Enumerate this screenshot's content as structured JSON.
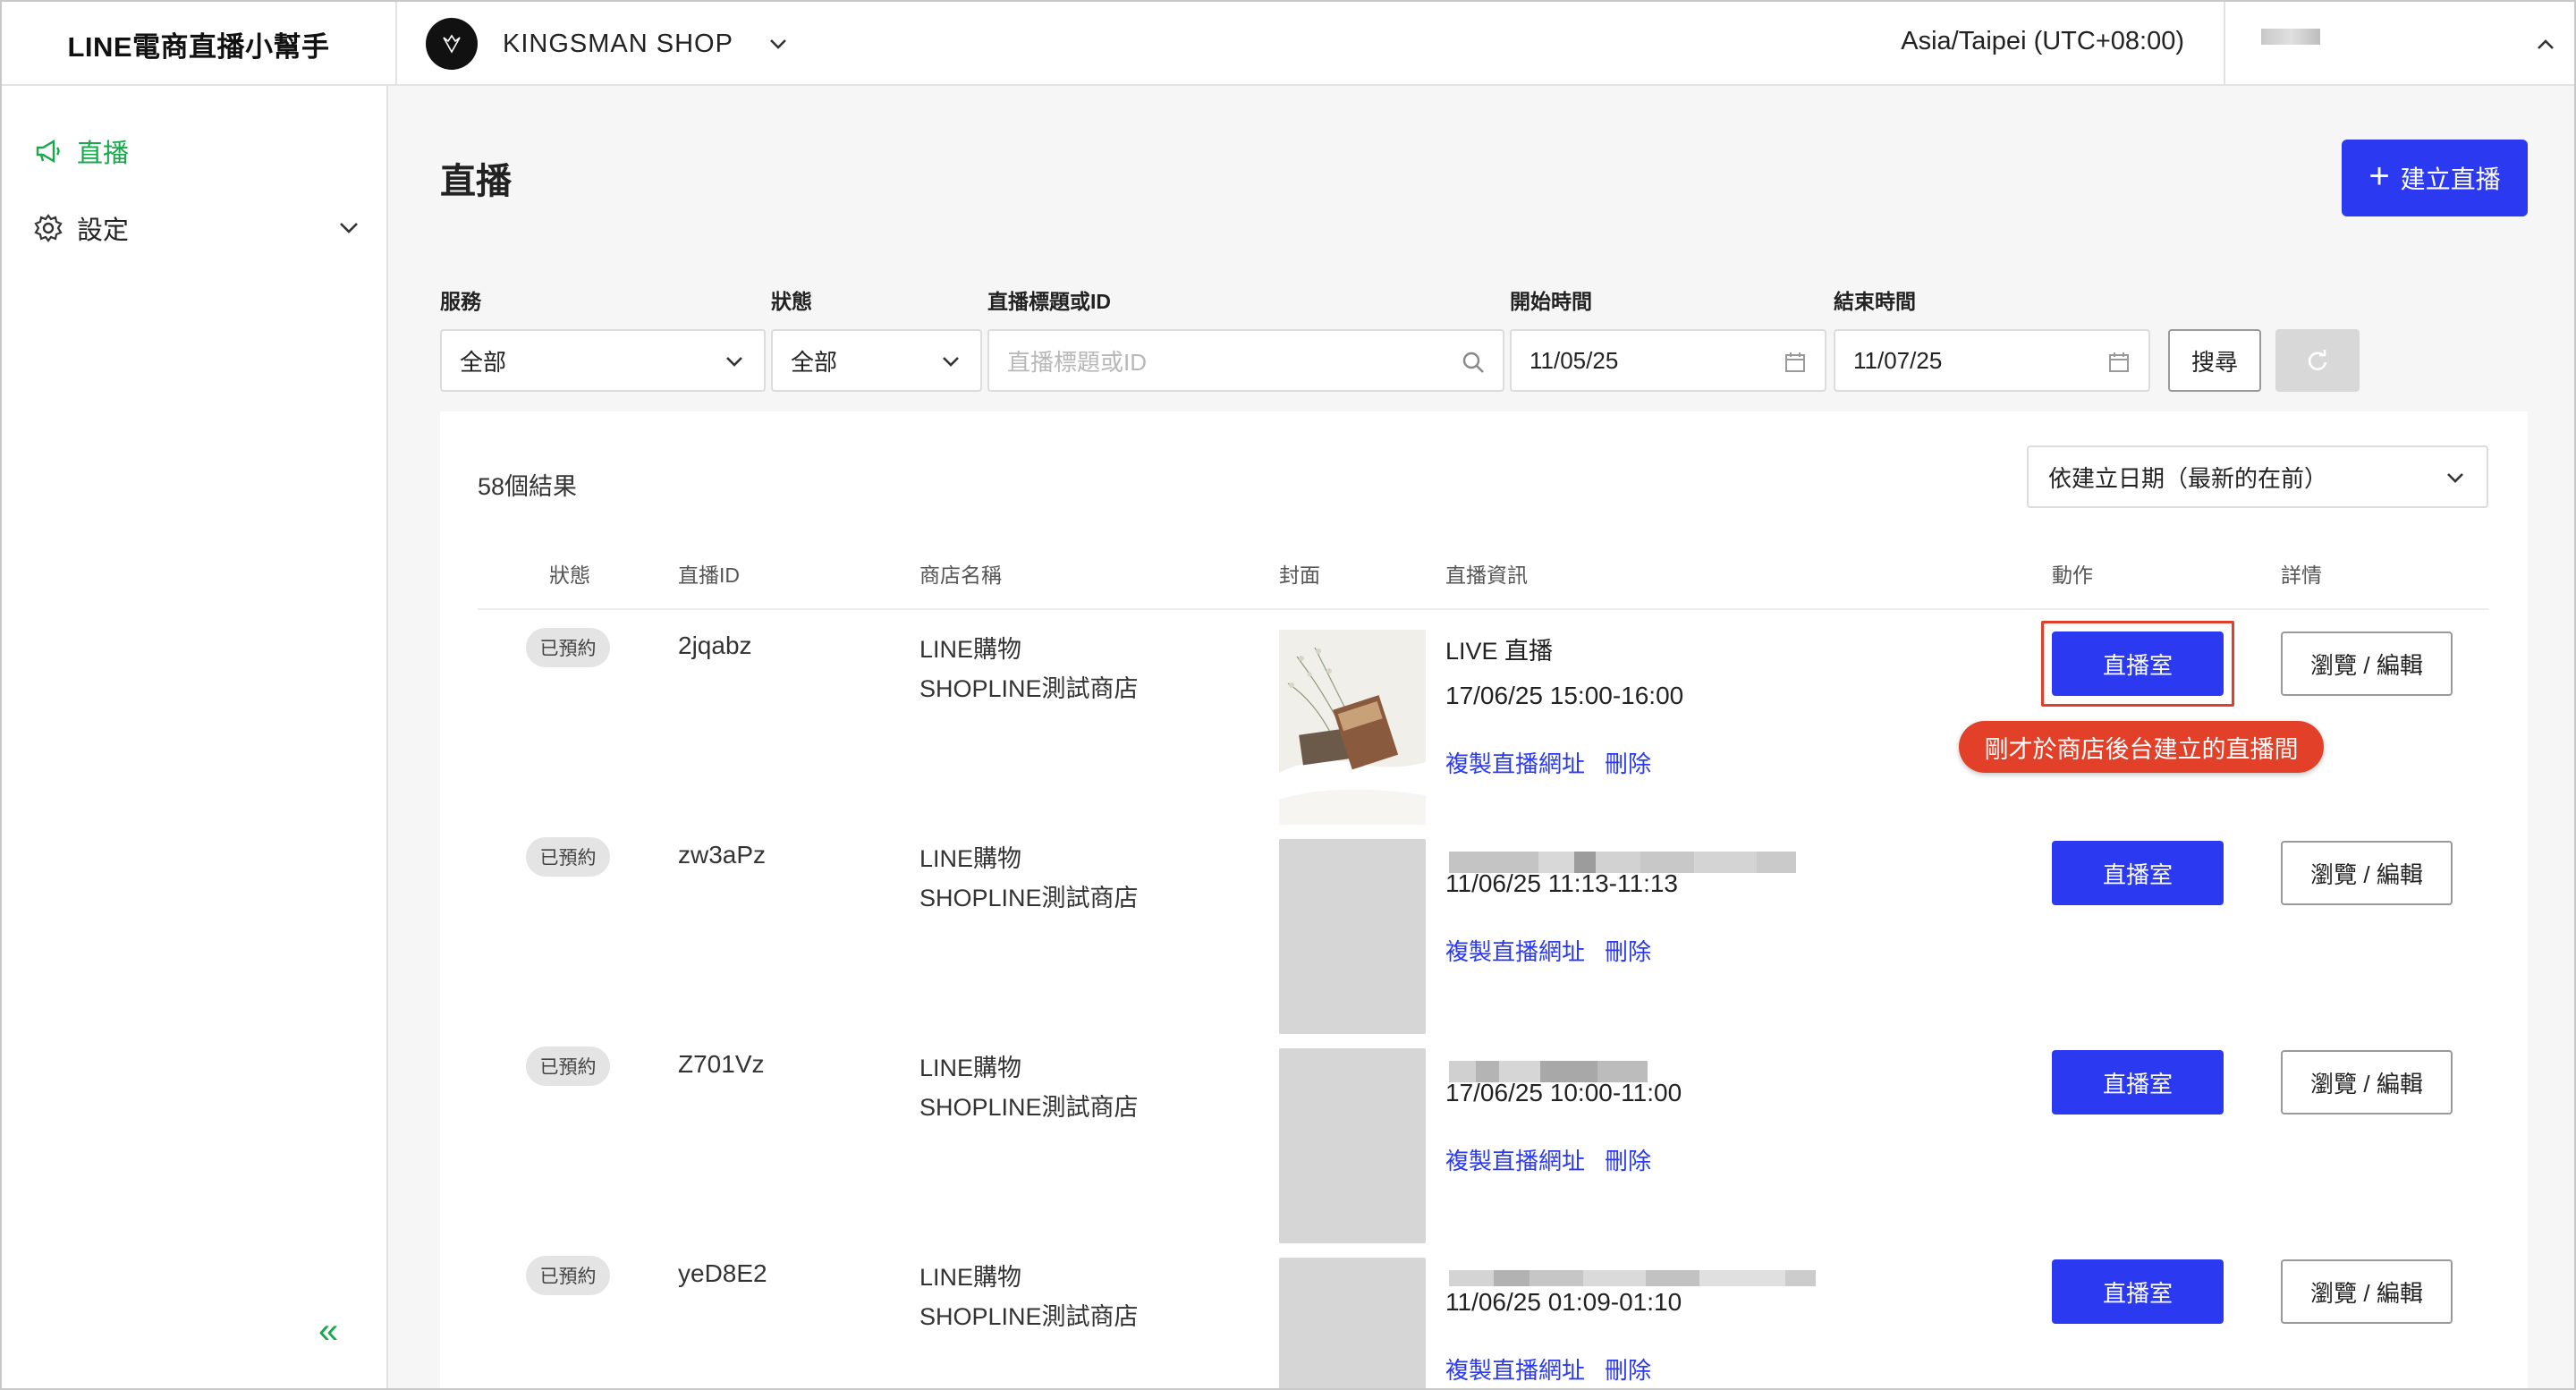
{
  "header": {
    "brand": "LINE電商直播小幫手",
    "shop_name": "KINGSMAN SHOP",
    "timezone": "Asia/Taipei (UTC+08:00)"
  },
  "sidebar": {
    "items": [
      {
        "label": "直播",
        "icon": "megaphone-icon",
        "active": true
      },
      {
        "label": "設定",
        "icon": "gear-icon",
        "active": false
      }
    ],
    "collapse_glyph": "«"
  },
  "main": {
    "title": "直播",
    "create_button": "建立直播",
    "filters": {
      "service_label": "服務",
      "service_value": "全部",
      "status_label": "狀態",
      "status_value": "全部",
      "query_label": "直播標題或ID",
      "query_placeholder": "直播標題或ID",
      "start_label": "開始時間",
      "start_value": "11/05/25",
      "end_label": "結束時間",
      "end_value": "11/07/25",
      "search_button": "搜尋"
    },
    "results": {
      "count": "58個結果",
      "sort": "依建立日期（最新的在前）",
      "columns": [
        "狀態",
        "直播ID",
        "商店名稱",
        "封面",
        "直播資訊",
        "動作",
        "詳情"
      ],
      "rows": [
        {
          "status": "已預約",
          "id": "2jqabz",
          "shop_line1": "LINE購物",
          "shop_line2": "SHOPLINE測試商店",
          "title": "LIVE 直播",
          "time": "17/06/25 15:00-16:00",
          "copy": "複製直播網址",
          "delete": "刪除",
          "room": "直播室",
          "edit": "瀏覽 / 編輯"
        },
        {
          "status": "已預約",
          "id": "zw3aPz",
          "shop_line1": "LINE購物",
          "shop_line2": "SHOPLINE測試商店",
          "title": "",
          "time": "11/06/25 11:13-11:13",
          "copy": "複製直播網址",
          "delete": "刪除",
          "room": "直播室",
          "edit": "瀏覽 / 編輯"
        },
        {
          "status": "已預約",
          "id": "Z701Vz",
          "shop_line1": "LINE購物",
          "shop_line2": "SHOPLINE測試商店",
          "title": "",
          "time": "17/06/25 10:00-11:00",
          "copy": "複製直播網址",
          "delete": "刪除",
          "room": "直播室",
          "edit": "瀏覽 / 編輯"
        },
        {
          "status": "已預約",
          "id": "yeD8E2",
          "shop_line1": "LINE購物",
          "shop_line2": "SHOPLINE測試商店",
          "title": "",
          "time": "11/06/25 01:09-01:10",
          "copy": "複製直播網址",
          "delete": "刪除",
          "room": "直播室",
          "edit": "瀏覽 / 編輯"
        }
      ]
    },
    "annotation": "剛才於商店後台建立的直播間"
  },
  "colors": {
    "accent": "#2b3af0",
    "brand_green": "#17a84b",
    "annotation_red": "#e3402a"
  }
}
